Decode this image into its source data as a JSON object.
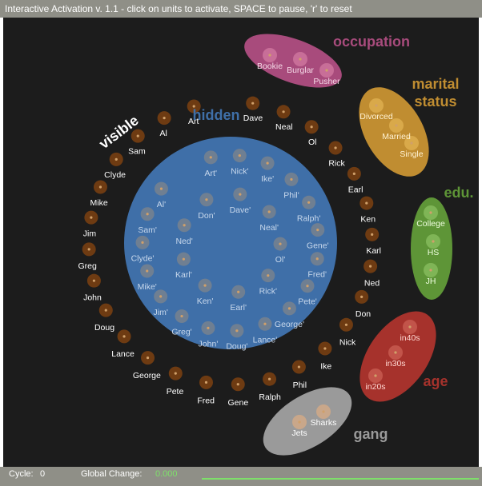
{
  "window": {
    "title": "Interactive Activation v. 1.1 - click on units to activate, SPACE to pause, 'r' to reset"
  },
  "status": {
    "cycle_label": "Cycle:",
    "cycle_value": "0",
    "change_label": "Global Change:",
    "change_value": "0.000"
  },
  "colors": {
    "background": "#1c1c1c",
    "hidden": "#3f6fa8",
    "occupation": "#a84b7c",
    "marital": "#c08d31",
    "edu": "#5e9537",
    "age": "#a6322c",
    "gang": "#9a9a9a",
    "visible_unit": "#6e3b12",
    "hidden_unit": "#6f7f92"
  },
  "group_labels": {
    "visible": "visible",
    "hidden": "hidden",
    "occupation": "occupation",
    "marital": [
      "marital",
      "status"
    ],
    "edu": "edu.",
    "age": "age",
    "gang": "gang"
  },
  "visible_units": [
    "Dave",
    "Neal",
    "Ol",
    "Rick",
    "Earl",
    "Ken",
    "Karl",
    "Ned",
    "Don",
    "Nick",
    "Ike",
    "Phil",
    "Ralph",
    "Gene",
    "Fred",
    "Pete",
    "George",
    "Lance",
    "Doug",
    "John",
    "Greg",
    "Jim",
    "Mike",
    "Clyde",
    "Sam",
    "Al",
    "Art"
  ],
  "hidden_units": {
    "outer": [
      "Art'",
      "Nick'",
      "Ike'",
      "Phil'",
      "Ralph'",
      "Gene'",
      "Fred'",
      "Pete'",
      "George'",
      "Lance'",
      "Doug'",
      "John'",
      "Greg'",
      "Jim'",
      "Mike'",
      "Clyde'",
      "Sam'",
      "Al'"
    ],
    "inner": [
      "Dave'",
      "Neal'",
      "Ol'",
      "Rick'",
      "Earl'",
      "Ken'",
      "Karl'",
      "Ned'",
      "Don'"
    ]
  },
  "property_units": {
    "occupation": [
      "Bookie",
      "Burglar",
      "Pusher"
    ],
    "marital": [
      "Divorced",
      "Married",
      "Single"
    ],
    "edu": [
      "College",
      "HS",
      "JH"
    ],
    "age": [
      "in40s",
      "in30s",
      "in20s"
    ],
    "gang": [
      "Sharks",
      "Jets"
    ]
  }
}
